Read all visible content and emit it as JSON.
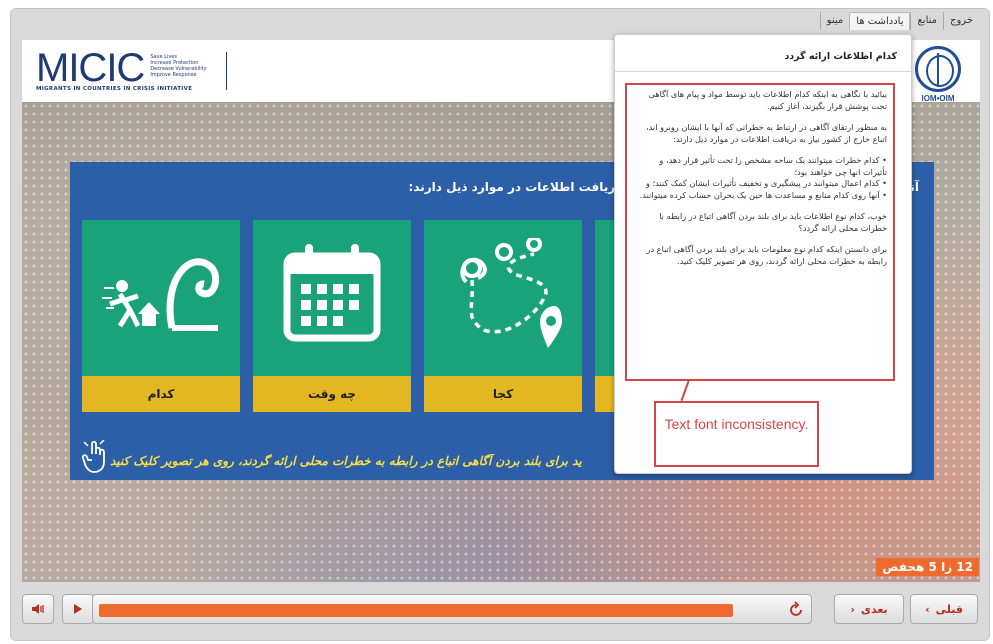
{
  "topnav": {
    "tabs": [
      "خروج",
      "منابع",
      "یادداشت ها",
      "مینو"
    ],
    "active_index": 2
  },
  "header": {
    "micic_word": "MICIC",
    "micic_tagline": [
      "Save Lives",
      "Increase Protection",
      "Decrease Vulnerability",
      "Improve Response"
    ],
    "micic_subtitle": "MIGRANTS IN COUNTRIES IN CRISIS INITIATIVE",
    "iom_text": "IOM•OIM"
  },
  "panel": {
    "heading": "آنها با ایشان روبرو اند، اتباع خارج از کشور نیاز به دریافت اطلاعات در موارد ذیل دارند:",
    "cards": [
      {
        "label": "کدام"
      },
      {
        "label": "چه وقت"
      },
      {
        "label": "کجا"
      },
      {
        "label": ""
      }
    ],
    "instruction": "ید برای بلند بردن آگاهی اتباع در رابطه به خطرات محلی ارائه گردند، روی هر تصویر کلیک کنید"
  },
  "popup": {
    "title": "کدام اطلاعات ارائه گردد",
    "para1": "بیائید با نگاهی به اینکه کدام اطلاعات باید توسط مواد و پیام های آگاهی تحت پوشش قرار بگیرند، آغاز کنیم.",
    "para2": "به منظور ارتقای آگاهی در ارتباط به خطراتی که آنها با ایشان روبرو اند، اتباع خارج از کشور نیاز به دریافت اطلاعات در موارد ذیل دارند:",
    "bullets": [
      "کدام خطرات میتوانند یک ساحه مشخص را تحت تأثیر قرار دهد، و تأثیرات انها چی خواهند بود؛",
      "کدام اعمال میتوانند در پیشگیری و تخفیف تأثیرات ایشان کمک کنند؛ و",
      "آنها روی کدام منابع و مساعدت ها حین یک بحران حساب کرده میتوانند."
    ],
    "para3": "خوب، کدام نوع اطلاعات باید برای بلند بردن آگاهی اتباع در رابطه با خطرات محلی ارائه گردد؟",
    "para4": "برای دانستن اینکه کدام نوع معلومات باید برای بلند بردن آگاهی اتباع در رابطه به خطرات محلی ارائه گردند، روی هر تصویر کلیک کنید."
  },
  "annotation": {
    "text": "Text font inconsistency."
  },
  "page_indicator": "12 زا 5 هحفص",
  "controls": {
    "next_label": "بعدی",
    "prev_label": "قبلی",
    "progress": 0.93
  },
  "colors": {
    "accent_orange": "#ef6a2e",
    "panel_blue": "#2d5ea8",
    "card_green": "#1aa37a",
    "card_label_yellow": "#e2b722",
    "annotation_red": "#d64545"
  }
}
